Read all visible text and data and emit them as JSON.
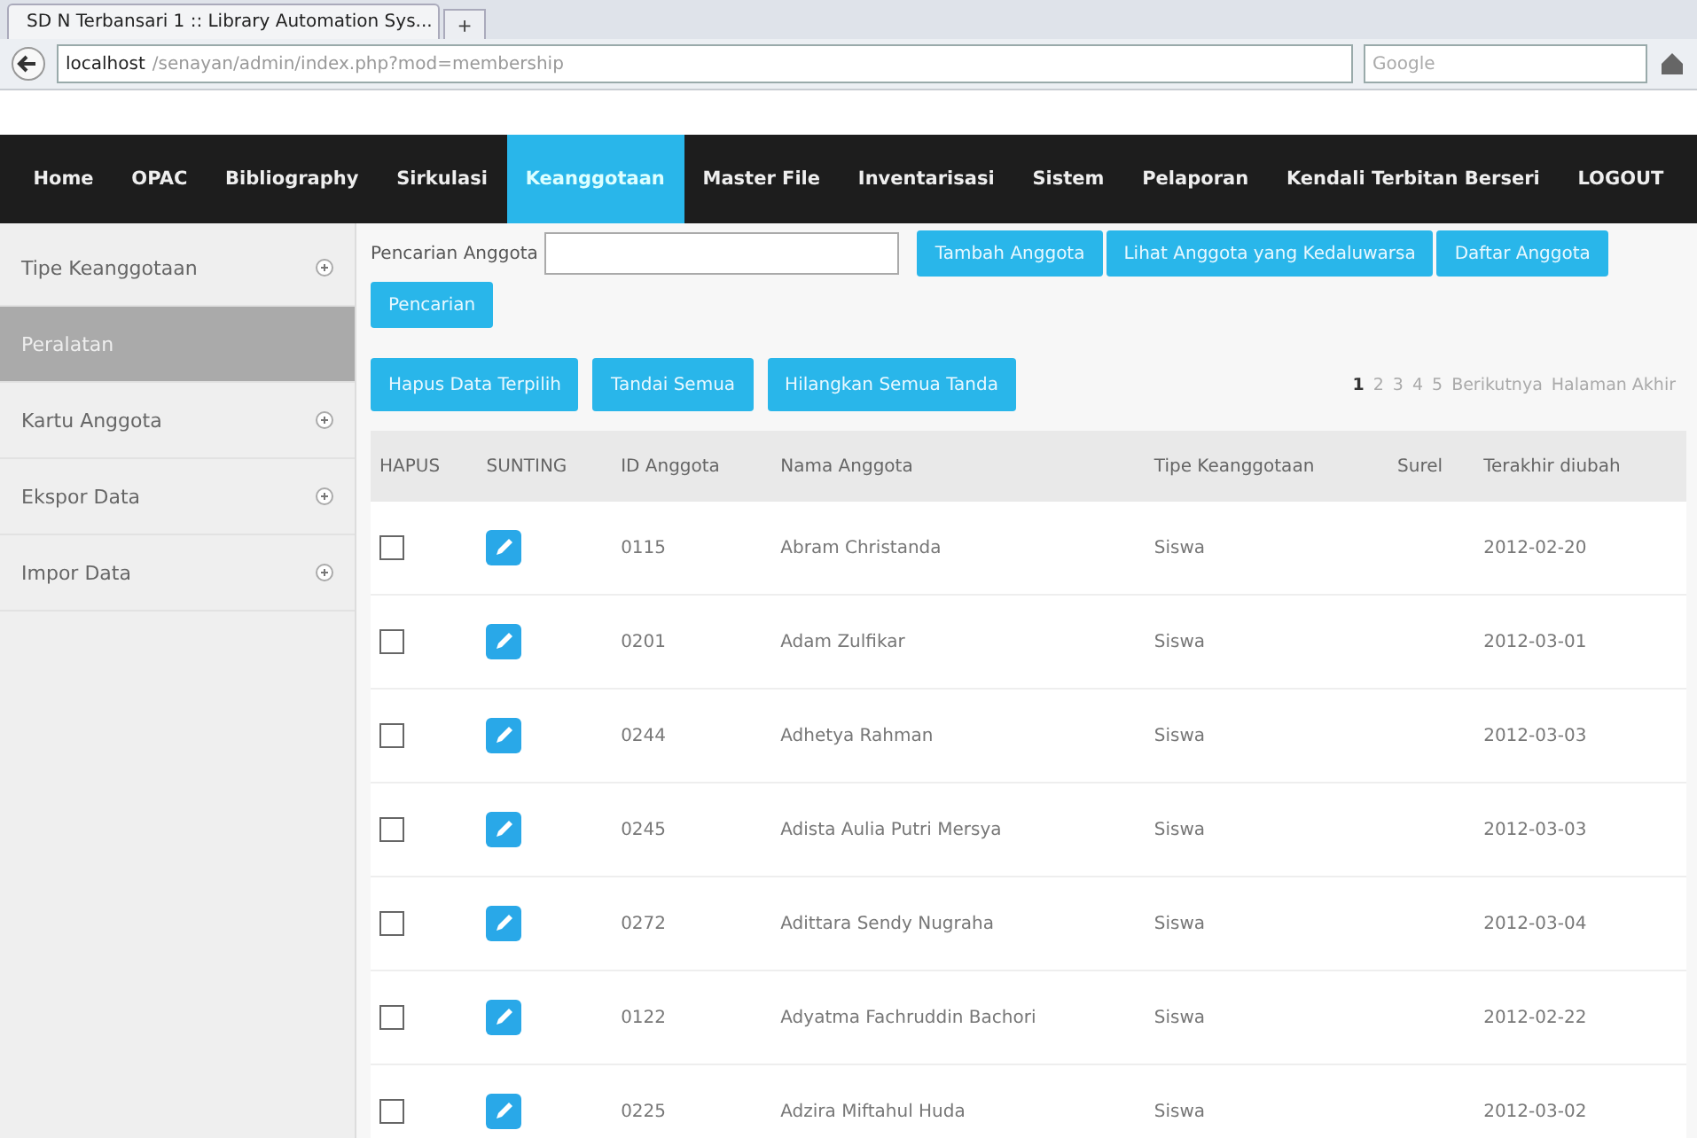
{
  "browser": {
    "tab_title": "SD N Terbansari 1 :: Library Automation Sys...",
    "new_tab": "+",
    "url_host": "localhost",
    "url_path": "/senayan/admin/index.php?mod=membership",
    "search_placeholder": "Google"
  },
  "nav": [
    {
      "label": "Home",
      "selected": false
    },
    {
      "label": "OPAC",
      "selected": false
    },
    {
      "label": "Bibliography",
      "selected": false
    },
    {
      "label": "Sirkulasi",
      "selected": false
    },
    {
      "label": "Keanggotaan",
      "selected": true
    },
    {
      "label": "Master File",
      "selected": false
    },
    {
      "label": "Inventarisasi",
      "selected": false
    },
    {
      "label": "Sistem",
      "selected": false
    },
    {
      "label": "Pelaporan",
      "selected": false
    },
    {
      "label": "Kendali Terbitan Berseri",
      "selected": false
    },
    {
      "label": "LOGOUT",
      "selected": false
    }
  ],
  "sidebar": {
    "items": [
      {
        "label": "Tipe Keanggotaan",
        "selected": false,
        "expandable": true
      },
      {
        "label": "Peralatan",
        "selected": true,
        "expandable": false
      },
      {
        "label": "Kartu Anggota",
        "selected": false,
        "expandable": true
      },
      {
        "label": "Ekspor Data",
        "selected": false,
        "expandable": true
      },
      {
        "label": "Impor Data",
        "selected": false,
        "expandable": true
      }
    ]
  },
  "search": {
    "label": "Pencarian Anggota",
    "button": "Pencarian"
  },
  "top_buttons": [
    "Tambah Anggota",
    "Lihat Anggota yang Kedaluwarsa",
    "Daftar Anggota"
  ],
  "action_buttons": [
    "Hapus Data Terpilih",
    "Tandai Semua",
    "Hilangkan Semua Tanda"
  ],
  "pagination": [
    {
      "label": "1",
      "selected": true
    },
    {
      "label": "2",
      "selected": false
    },
    {
      "label": "3",
      "selected": false
    },
    {
      "label": "4",
      "selected": false
    },
    {
      "label": "5",
      "selected": false
    },
    {
      "label": "Berikutnya",
      "selected": false
    },
    {
      "label": "Halaman Akhir",
      "selected": false
    }
  ],
  "table": {
    "columns": [
      "HAPUS",
      "SUNTING",
      "ID Anggota",
      "Nama Anggota",
      "Tipe Keanggotaan",
      "Surel",
      "Terakhir diubah"
    ],
    "rows": [
      {
        "checked": false,
        "id": "0115",
        "name": "Abram Christanda",
        "type": "Siswa",
        "updated": "2012-02-20"
      },
      {
        "checked": false,
        "id": "0201",
        "name": "Adam Zulfikar",
        "type": "Siswa",
        "updated": "2012-03-01"
      },
      {
        "checked": false,
        "id": "0244",
        "name": "Adhetya Rahman",
        "type": "Siswa",
        "updated": "2012-03-03"
      },
      {
        "checked": false,
        "id": "0245",
        "name": "Adista Aulia Putri Mersya",
        "type": "Siswa",
        "updated": "2012-03-03"
      },
      {
        "checked": false,
        "id": "0272",
        "name": "Adittara Sendy Nugraha",
        "type": "Siswa",
        "updated": "2012-03-04"
      },
      {
        "checked": false,
        "id": "0122",
        "name": "Adyatma Fachruddin Bachori",
        "type": "Siswa",
        "updated": "2012-02-22"
      },
      {
        "checked": false,
        "id": "0225",
        "name": "Adzira Miftahul Huda",
        "type": "Siswa",
        "updated": "2012-03-02"
      }
    ]
  }
}
